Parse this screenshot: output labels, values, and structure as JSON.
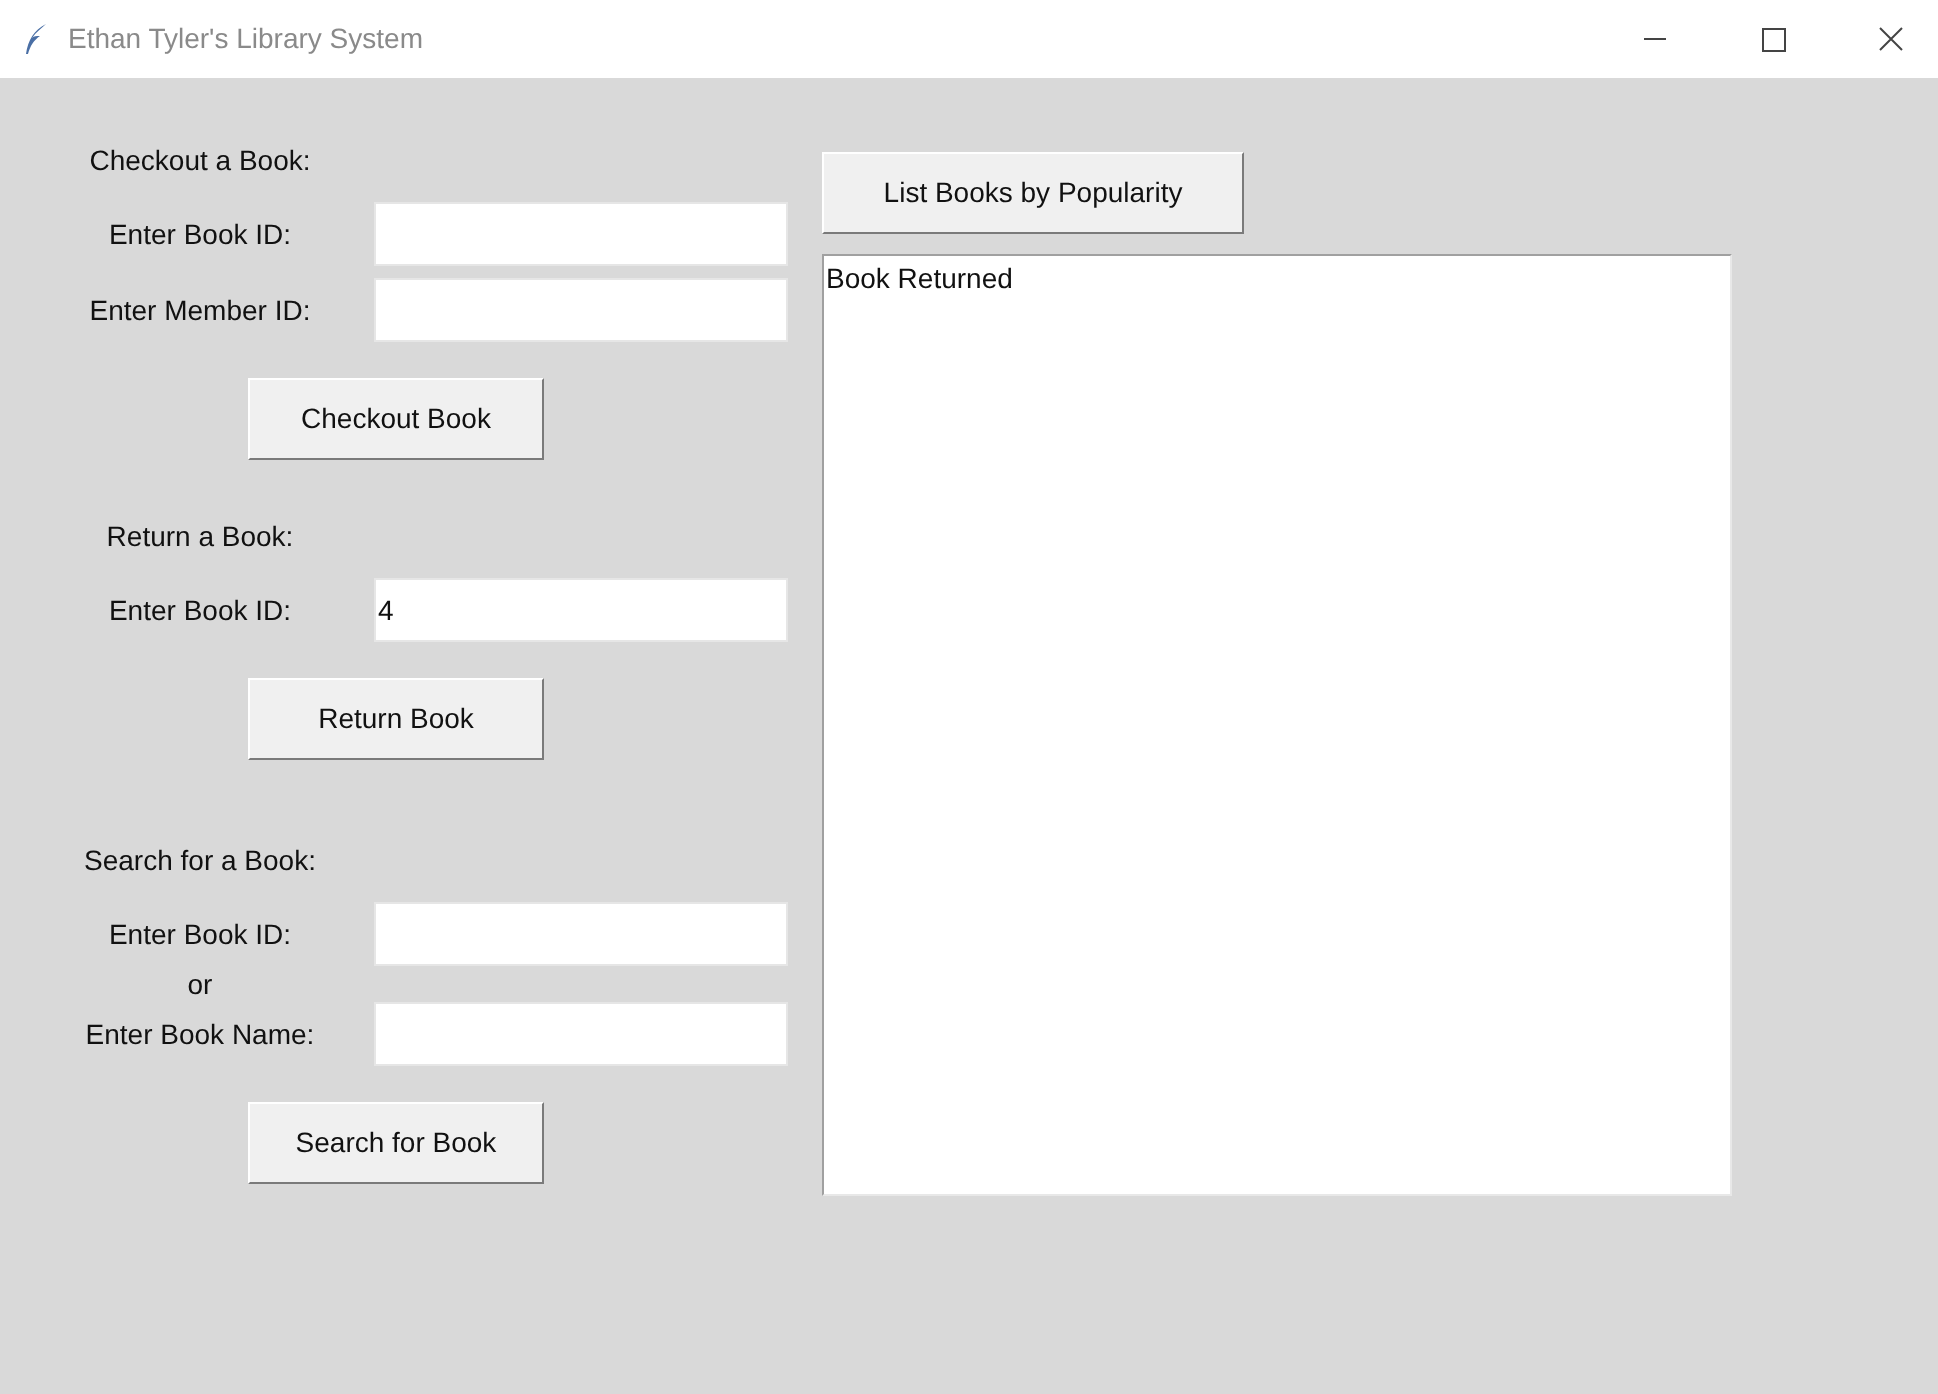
{
  "window": {
    "title": "Ethan Tyler's Library System"
  },
  "sections": [
    {
      "heading": "Checkout a Book:",
      "fields": [
        {
          "kind": "entry",
          "label": "Enter Book ID:"
        },
        {
          "kind": "entry",
          "label": "Enter Member ID:"
        }
      ],
      "button": "Checkout Book"
    },
    {
      "heading": "Return a Book:",
      "fields": [
        {
          "kind": "entry",
          "label": "Enter Book ID:",
          "value": "4"
        }
      ],
      "button": "Return Book"
    },
    {
      "heading": "Search for a Book:",
      "fields": [
        {
          "kind": "entry",
          "label": "Enter Book ID:"
        },
        {
          "kind": "separator",
          "text": "or"
        },
        {
          "kind": "entry",
          "label": "Enter Book Name:"
        }
      ],
      "button": "Search for Book"
    }
  ],
  "list_button": "List Books by Popularity",
  "output": {
    "lines": [
      "Book Returned"
    ]
  }
}
